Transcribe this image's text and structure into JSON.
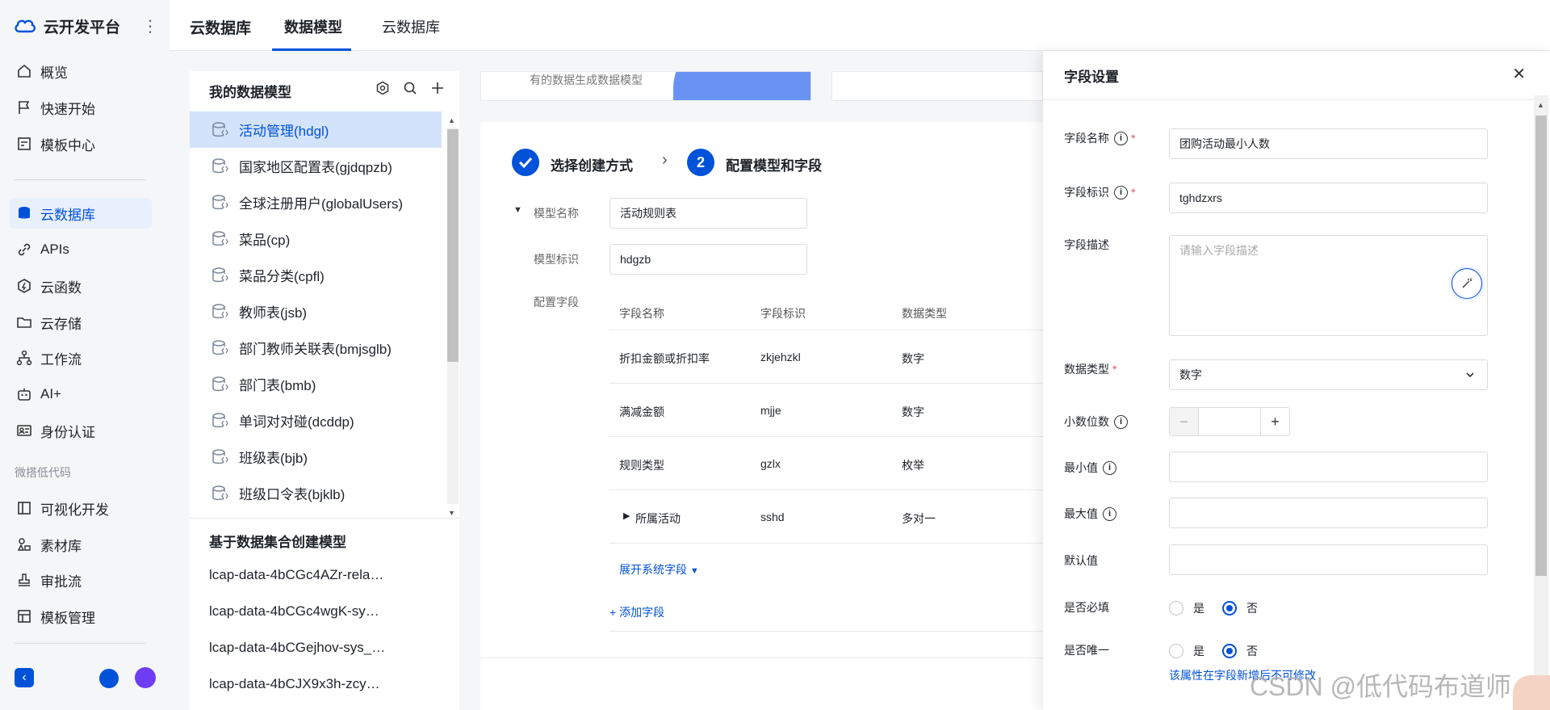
{
  "brand": {
    "name": "云开发平台"
  },
  "nav": {
    "items": [
      {
        "label": "概览",
        "icon": "home-icon"
      },
      {
        "label": "快速开始",
        "icon": "flag-icon"
      },
      {
        "label": "模板中心",
        "icon": "template-icon"
      },
      {
        "label": "云数据库",
        "icon": "database-icon",
        "active": true
      },
      {
        "label": "APIs",
        "icon": "link-icon"
      },
      {
        "label": "云函数",
        "icon": "function-icon"
      },
      {
        "label": "云存储",
        "icon": "folder-icon"
      },
      {
        "label": "工作流",
        "icon": "workflow-icon"
      },
      {
        "label": "AI+",
        "icon": "robot-icon"
      },
      {
        "label": "身份认证",
        "icon": "id-card-icon"
      }
    ],
    "group_label": "微搭低代码",
    "group_items": [
      {
        "label": "可视化开发",
        "icon": "layout-icon"
      },
      {
        "label": "素材库",
        "icon": "assets-icon"
      },
      {
        "label": "审批流",
        "icon": "stamp-icon"
      },
      {
        "label": "模板管理",
        "icon": "template-manage-icon"
      }
    ]
  },
  "topbar": {
    "title": "云数据库",
    "tabs": [
      {
        "label": "数据模型",
        "active": true
      },
      {
        "label": "云数据库",
        "active": false
      }
    ]
  },
  "model_panel": {
    "title": "我的数据模型",
    "items": [
      {
        "label": "活动管理(hdgl)",
        "active": true
      },
      {
        "label": "国家地区配置表(gjdqpzb)"
      },
      {
        "label": "全球注册用户(globalUsers)"
      },
      {
        "label": "菜品(cp)"
      },
      {
        "label": "菜品分类(cpfl)"
      },
      {
        "label": "教师表(jsb)"
      },
      {
        "label": "部门教师关联表(bmjsglb)"
      },
      {
        "label": "部门表(bmb)"
      },
      {
        "label": "单词对对碰(dcddp)"
      },
      {
        "label": "班级表(bjb)"
      },
      {
        "label": "班级口令表(bjklb)"
      }
    ],
    "section2_title": "基于数据集合创建模型",
    "dataset_items": [
      "lcap-data-4bCGc4AZr-rela…",
      "lcap-data-4bCGc4wgK-sy…",
      "lcap-data-4bCGejhov-sys_…",
      "lcap-data-4bCJX9x3h-zcy…"
    ]
  },
  "banner": {
    "text": "有的数据生成数据模型"
  },
  "steps": [
    {
      "label": "选择创建方式",
      "status": "done"
    },
    {
      "num": "2",
      "label": "配置模型和字段",
      "status": "current"
    }
  ],
  "form": {
    "model_name_label": "模型名称",
    "model_name_value": "活动规则表",
    "model_id_label": "模型标识",
    "model_id_value": "hdgzb",
    "fields_label": "配置字段"
  },
  "fields_table": {
    "headers": [
      "字段名称",
      "字段标识",
      "数据类型"
    ],
    "rows": [
      {
        "name": "折扣金额或折扣率",
        "id": "zkjehzkl",
        "type": "数字"
      },
      {
        "name": "满减金额",
        "id": "mjje",
        "type": "数字"
      },
      {
        "name": "规则类型",
        "id": "gzlx",
        "type": "枚举"
      },
      {
        "name": "所属活动",
        "id": "sshd",
        "type": "多对一",
        "expandable": true
      }
    ],
    "expand_system": "展开系统字段",
    "add_field": "+ 添加字段"
  },
  "drawer": {
    "title": "字段设置",
    "field_name_label": "字段名称",
    "field_name_value": "团购活动最小人数",
    "field_id_label": "字段标识",
    "field_id_value": "tghdzxrs",
    "desc_label": "字段描述",
    "desc_placeholder": "请输入字段描述",
    "type_label": "数据类型",
    "type_value": "数字",
    "decimal_label": "小数位数",
    "min_label": "最小值",
    "max_label": "最大值",
    "default_label": "默认值",
    "required_label": "是否必填",
    "unique_label": "是否唯一",
    "yes": "是",
    "no": "否",
    "required_value": "否",
    "unique_value": "否",
    "unique_hint": "该属性在字段新增后不可修改"
  },
  "watermark": "CSDN @低代码布道师",
  "colors": {
    "primary": "#0052d9",
    "required": "#e34d59",
    "active_bg": "#d4e3fc"
  }
}
